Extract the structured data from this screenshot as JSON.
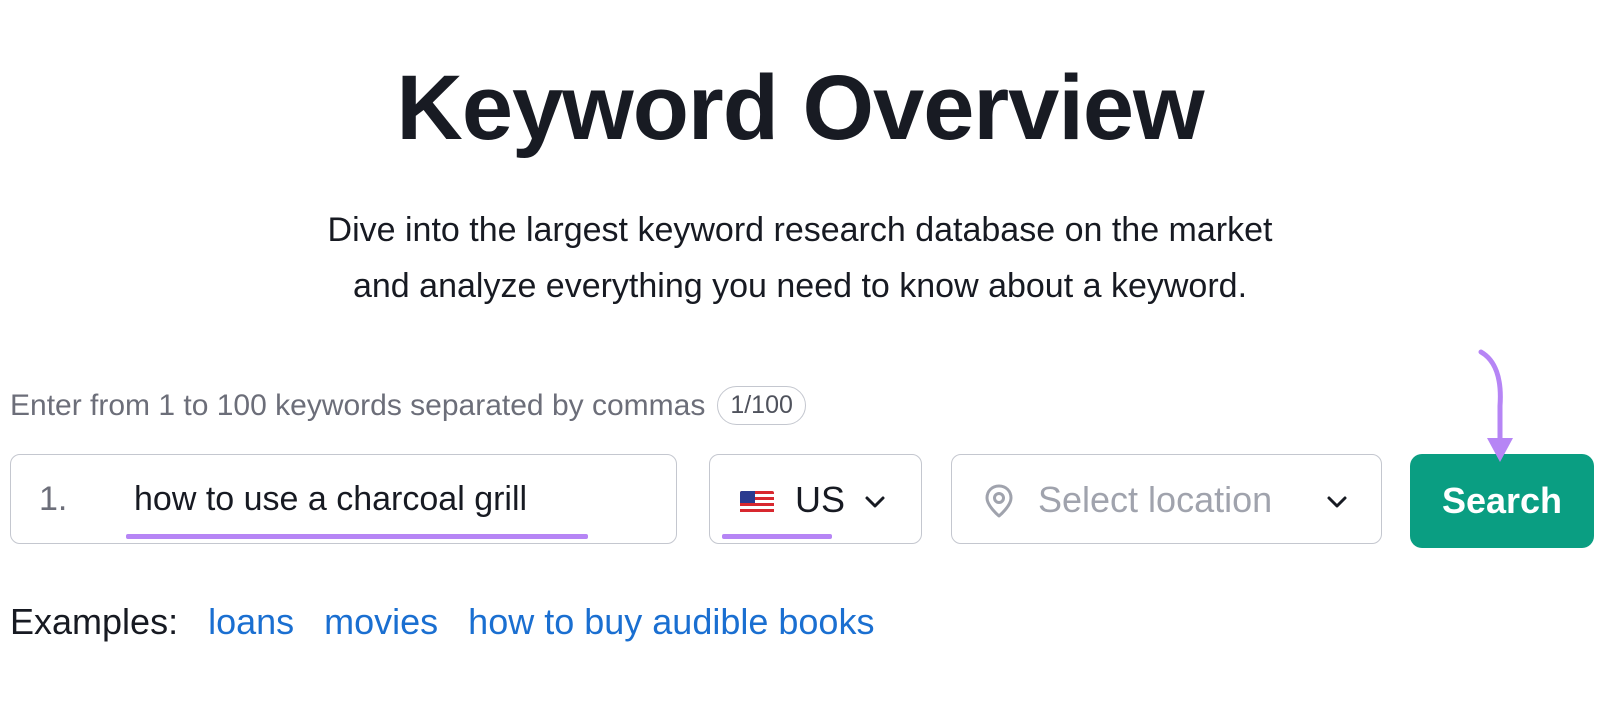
{
  "header": {
    "title": "Keyword Overview",
    "subtitle_line1": "Dive into the largest keyword research database on the market",
    "subtitle_line2": "and analyze everything you need to know about a keyword."
  },
  "form": {
    "instructions": "Enter from 1 to 100 keywords separated by commas",
    "count": "1/100",
    "keywords": [
      {
        "index": "1.",
        "value": "how to use a charcoal grill"
      }
    ],
    "country": {
      "code": "US",
      "flag_icon": "us-flag-icon"
    },
    "location": {
      "placeholder": "Select location",
      "icon": "location-pin-icon"
    },
    "search_label": "Search"
  },
  "examples": {
    "label": "Examples:",
    "links": [
      "loans",
      "movies",
      "how to buy audible books"
    ]
  },
  "colors": {
    "accent_button": "#0a9e82",
    "annotation": "#b685f5",
    "link": "#1a6fd1"
  }
}
